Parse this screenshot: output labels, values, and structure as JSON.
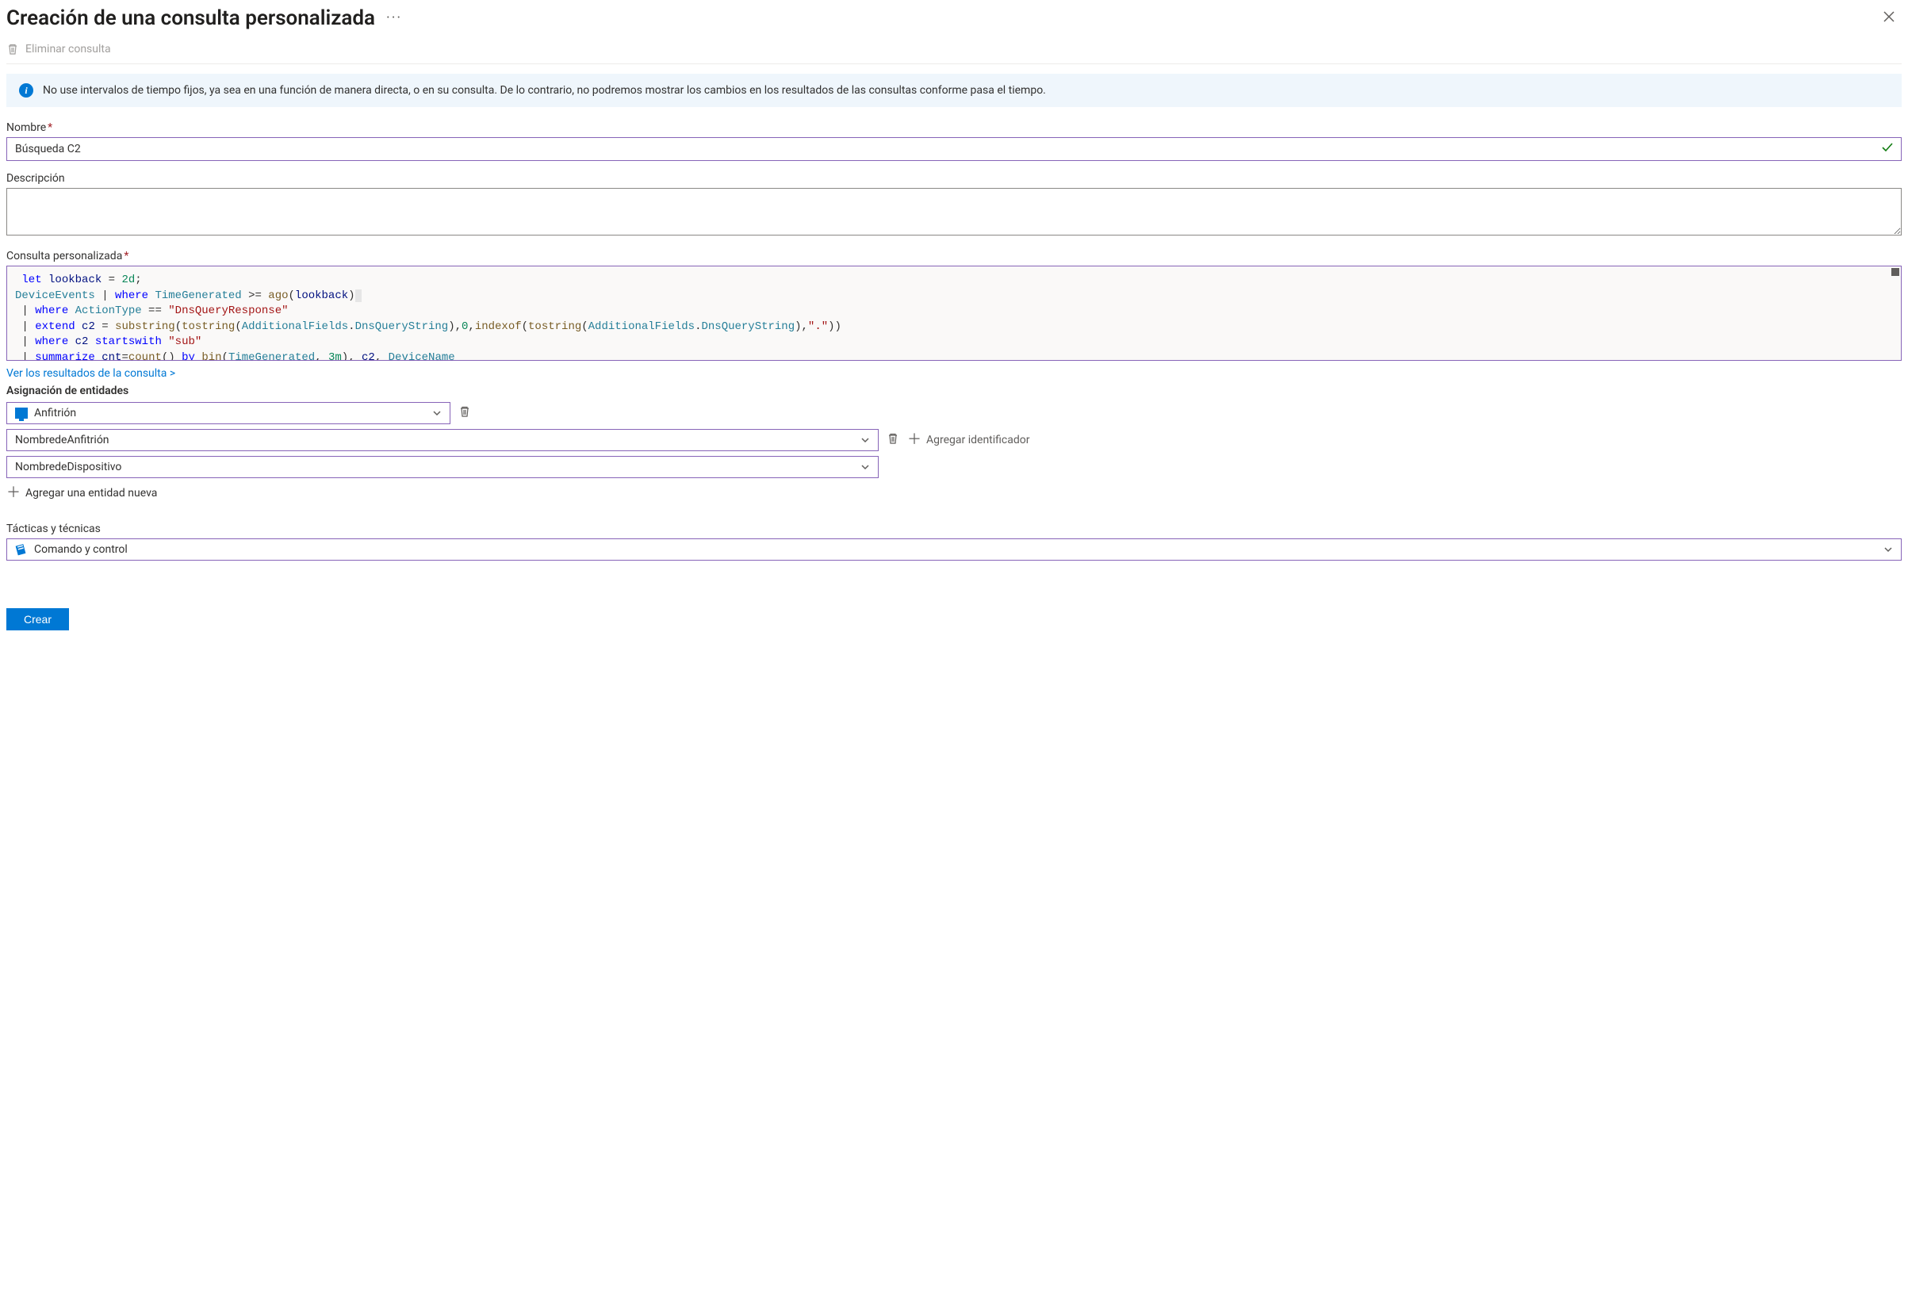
{
  "header": {
    "title": "Creación de una consulta personalizada"
  },
  "toolbar": {
    "delete_label": "Eliminar consulta"
  },
  "info_banner": {
    "text": "No use intervalos de tiempo fijos, ya sea en una función de manera directa, o en su consulta. De lo contrario, no podremos mostrar los cambios en los resultados de las consultas conforme pasa el tiempo."
  },
  "fields": {
    "name_label": "Nombre",
    "name_value": "Búsqueda C2",
    "description_label": "Descripción",
    "description_value": "",
    "query_label": "Consulta personalizada",
    "query_text": " let lookback = 2d;\nDeviceEvents | where TimeGenerated >= ago(lookback)\n | where ActionType == \"DnsQueryResponse\"\n | extend c2 = substring(tostring(AdditionalFields.DnsQueryString),0,indexof(tostring(AdditionalFields.DnsQueryString),\".\"))\n | where c2 startswith \"sub\"\n | summarize cnt=count() by bin(TimeGenerated, 3m), c2, DeviceName",
    "view_results_link": "Ver los resultados de la consulta >"
  },
  "entity_mapping": {
    "heading": "Asignación de entidades",
    "entity_type": "Anfitrión",
    "identifier1": "NombredeAnfitrión",
    "identifier2": "NombredeDispositivo",
    "add_identifier_label": "Agregar identificador",
    "add_entity_label": "Agregar una entidad nueva"
  },
  "tactics": {
    "label": "Tácticas y técnicas",
    "value": "Comando y control"
  },
  "footer": {
    "create_label": "Crear"
  }
}
